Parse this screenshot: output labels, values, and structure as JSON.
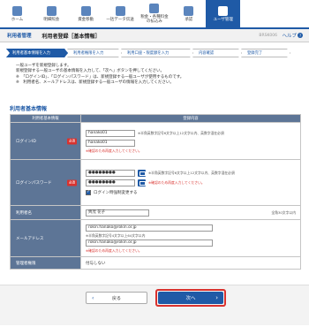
{
  "nav": [
    {
      "label": "ホーム",
      "active": false
    },
    {
      "label": "明細照会",
      "active": false
    },
    {
      "label": "資金移動",
      "active": false
    },
    {
      "label": "一括データ伝送",
      "active": false
    },
    {
      "label": "税金・各種料金\nの払込み",
      "active": false
    },
    {
      "label": "承認",
      "active": false
    },
    {
      "label": "ユーザ管理",
      "active": true
    }
  ],
  "title": {
    "section": "利用者管理",
    "page": "利用者登録［基本情報］",
    "code": "BRSK006",
    "help": "ヘルプ"
  },
  "steps": [
    {
      "label": "利用者基本情報を入力",
      "current": true
    },
    {
      "label": "利用者権限を入力",
      "current": false
    },
    {
      "label": "利用口座・限度額を入力",
      "current": false
    },
    {
      "label": "内容確認",
      "current": false
    },
    {
      "label": "登録完了",
      "current": false
    }
  ],
  "intro": {
    "line1": "一般ユーザを新規登録します。",
    "line2": "新規登録する一般ユーザの基本情報を入力して、「次へ」ボタンを押してください。",
    "line3": "※　「ログインID」、「ログインパスワード」は、新規登録する一般ユーザが使用するものです。",
    "line4": "※　利用者名、メールアドレスは、新規登録する一般ユーザの情報を入力してください。"
  },
  "section_title": "利用者基本情報",
  "table": {
    "head_label": "利用者基本情報",
    "head_value": "登録内容",
    "required": "必須",
    "login_id": {
      "label": "ログインID",
      "value": "hanako01",
      "confirm": "hanako01",
      "note": "※半角英数字記号6文字以上12文字以内、英数字混在必須",
      "confirm_note": "※確認のため再度入力してください。"
    },
    "password": {
      "label": "ログインパスワード",
      "value": "●●●●●●●●",
      "confirm": "●●●●●●●●",
      "note": "※半角英数字記号6文字以上12文字以内、英数字混在必須",
      "confirm_note": "※確認のため再度入力してください。",
      "force_change": "ログイン時強制変更する"
    },
    "name": {
      "label": "利用者名",
      "value": "齊茂 花子",
      "note": "全角30文字以内"
    },
    "email": {
      "label": "メールアドレス",
      "value": "rokin.hanako@rokin.or.jp",
      "note": "※半角英数字記号4文字以上64文字以内",
      "confirm": "rokin.hanako@rokin.or.jp",
      "confirm_note": "※確認のため再度入力してください。"
    },
    "admin": {
      "label": "管理者権限",
      "value": "付与しない"
    }
  },
  "buttons": {
    "back": "戻る",
    "next": "次へ"
  }
}
